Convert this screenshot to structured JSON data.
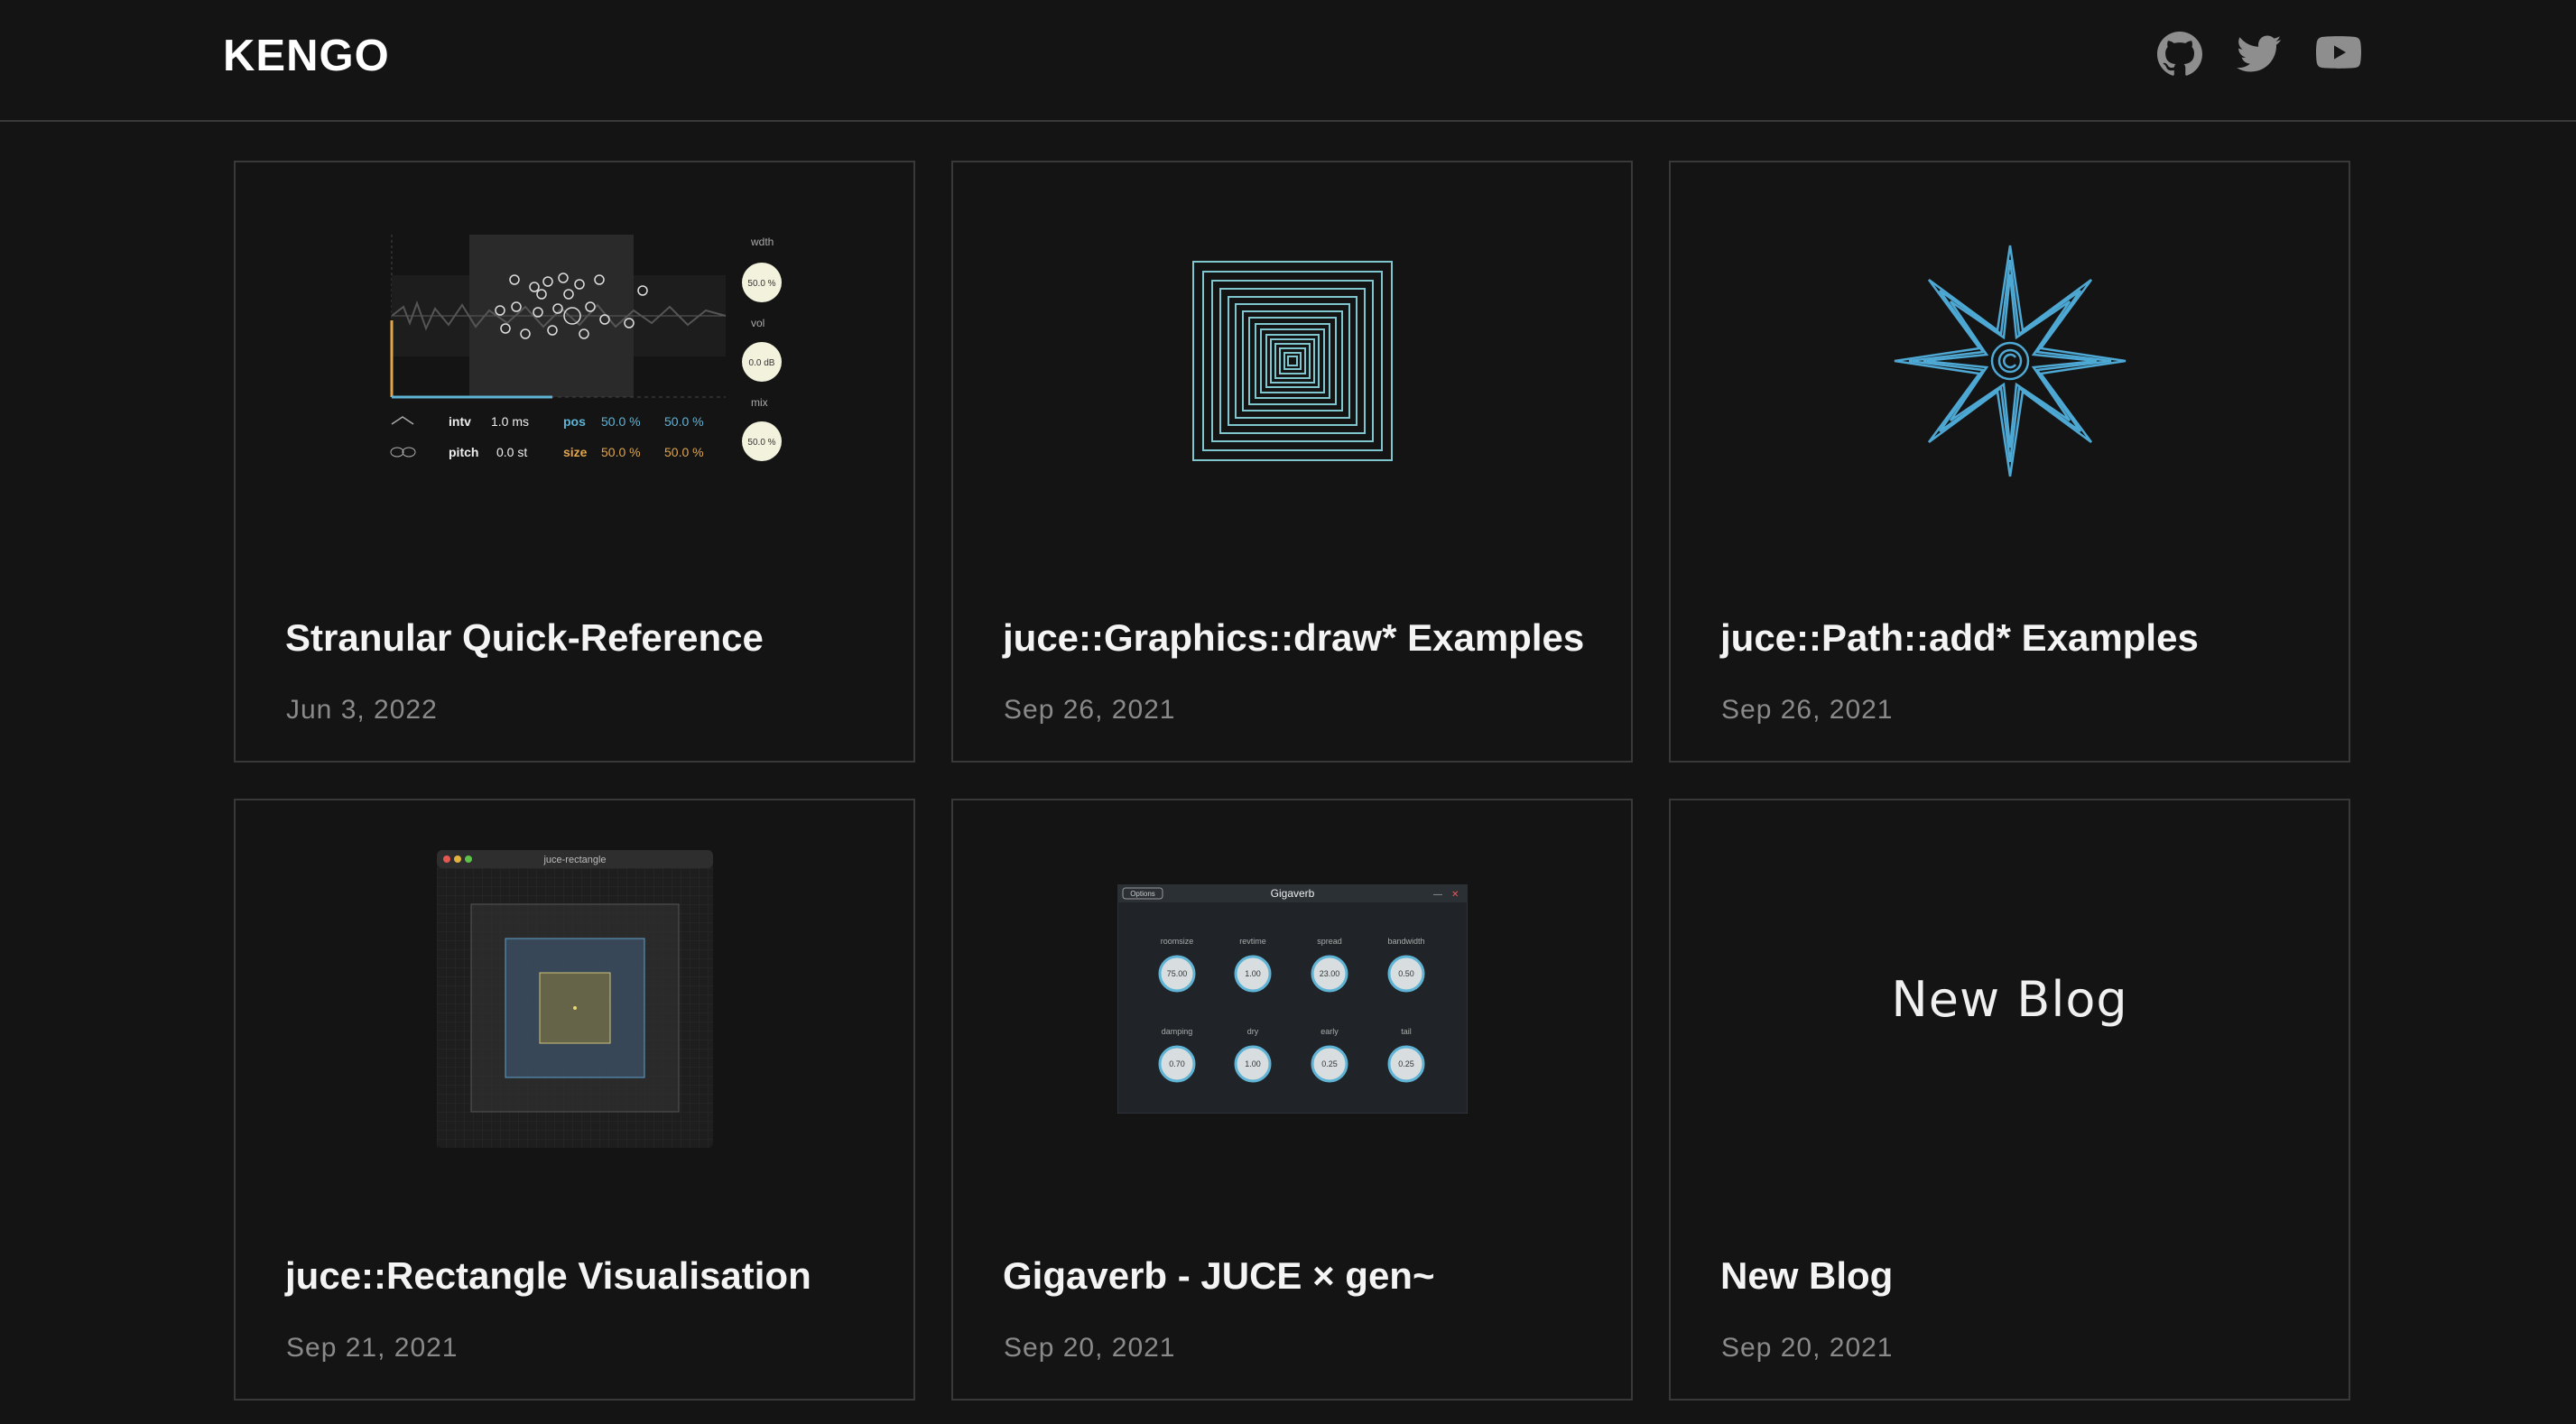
{
  "header": {
    "brand": "KENGO",
    "social": [
      {
        "name": "github-icon"
      },
      {
        "name": "twitter-icon"
      },
      {
        "name": "youtube-icon"
      }
    ]
  },
  "colors": {
    "background": "#141414",
    "border": "#393939",
    "accent_blue": "#5fb4d6",
    "accent_orange": "#e2a54a",
    "date": "#8a8a8a"
  },
  "posts": [
    {
      "title": "Stranular Quick-Reference",
      "date": "Jun 3, 2022",
      "thumb": {
        "labels": {
          "wdth": "wdth",
          "vol": "vol",
          "mix": "mix",
          "intv": "intv",
          "pitch": "pitch",
          "pos": "pos",
          "size": "size"
        },
        "values": {
          "wdth": "50.0 %",
          "vol": "0.0 dB",
          "mix": "50.0 %",
          "intv": "1.0 ms",
          "pitch": "0.0 st",
          "pos_a": "50.0 %",
          "pos_b": "50.0 %",
          "size_a": "50.0 %",
          "size_b": "50.0 %"
        }
      }
    },
    {
      "title": "juce::Graphics::draw* Examples",
      "date": "Sep 26, 2021"
    },
    {
      "title": "juce::Path::add* Examples",
      "date": "Sep 26, 2021"
    },
    {
      "title": "juce::Rectangle Visualisation",
      "date": "Sep 21, 2021",
      "thumb": {
        "window_title": "juce-rectangle"
      }
    },
    {
      "title": "Gigaverb - JUCE × gen~",
      "date": "Sep 20, 2021",
      "thumb": {
        "window_title": "Gigaverb",
        "options_label": "Options",
        "knobs": [
          {
            "label": "roomsize",
            "value": "75.00"
          },
          {
            "label": "revtime",
            "value": "1.00"
          },
          {
            "label": "spread",
            "value": "23.00"
          },
          {
            "label": "bandwidth",
            "value": "0.50"
          },
          {
            "label": "damping",
            "value": "0.70"
          },
          {
            "label": "dry",
            "value": "1.00"
          },
          {
            "label": "early",
            "value": "0.25"
          },
          {
            "label": "tail",
            "value": "0.25"
          }
        ]
      }
    },
    {
      "title": "New Blog",
      "date": "Sep 20, 2021",
      "thumb": {
        "text": "New Blog"
      }
    }
  ]
}
